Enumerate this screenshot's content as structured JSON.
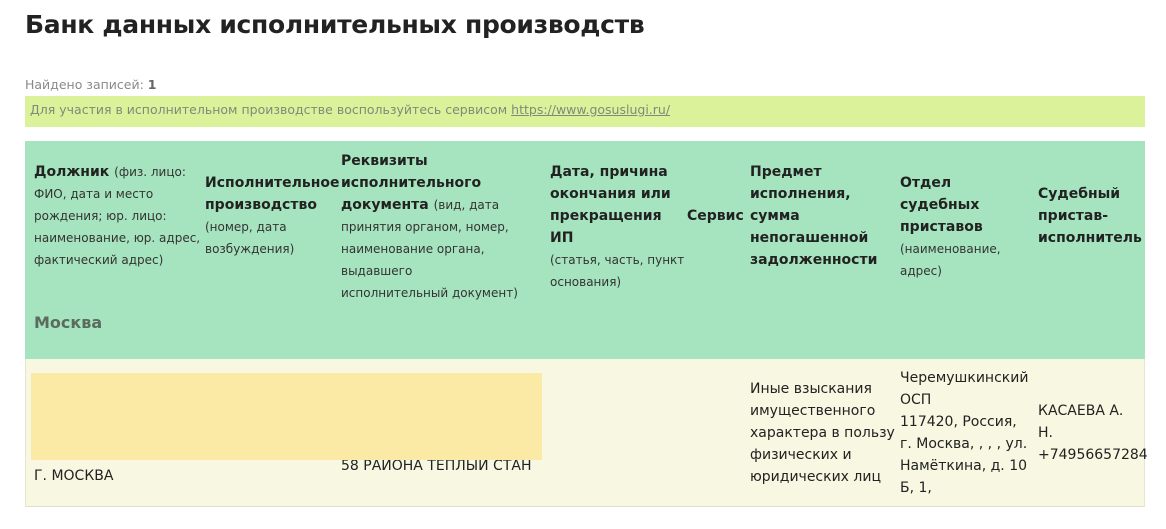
{
  "page": {
    "title": "Банк данных исполнительных производств",
    "found_label": "Найдено записей:",
    "found_count": "1",
    "notice_text": "Для участия в исполнительном производстве воспользуйтесь сервисом ",
    "notice_link": "https://www.gosuslugi.ru/"
  },
  "table": {
    "headers": [
      {
        "bold_lines": [
          "Должник"
        ],
        "inline_sub": "(физ. лицо:",
        "sub_lines": [
          "ФИО, дата и место",
          "рождения; юр. лицо:",
          "наименование, юр. адрес,",
          "фактический адрес)"
        ]
      },
      {
        "bold_lines": [
          "Исполнительное",
          "производство"
        ],
        "sub_lines": [
          "(номер, дата",
          "возбуждения)"
        ]
      },
      {
        "bold_lines": [
          "Реквизиты",
          "исполнительного"
        ],
        "last_bold": "документа",
        "inline_sub": "(вид, дата",
        "sub_lines": [
          "принятия органом, номер,",
          "наименование органа, выдавшего",
          "исполнительный документ)"
        ]
      },
      {
        "bold_lines": [
          "Дата, причина",
          "окончания или",
          "прекращения ИП"
        ],
        "sub_lines": [
          "(статья, часть, пункт",
          "основания)"
        ]
      },
      {
        "bold_lines": [
          "Сервис"
        ]
      },
      {
        "bold_lines": [
          "Предмет",
          "исполнения,",
          "сумма",
          "непогашенной",
          "задолженности"
        ]
      },
      {
        "bold_lines": [
          "Отдел судебных",
          "приставов"
        ],
        "sub_lines": [
          "(наименование,",
          "адрес)"
        ]
      },
      {
        "bold_lines": [
          "Судебный",
          "пристав-",
          "исполнитель"
        ]
      }
    ],
    "region": "Москва",
    "row": {
      "debtor": "Г. МОСКВА",
      "document": "58 РАЙОНА ТЕПЛЫЙ СТАН",
      "subject_lines": [
        "Иные взыскания",
        "имущественного",
        "характера в пользу",
        "физических и",
        "юридических лиц"
      ],
      "department_lines": [
        "Черемушкинский",
        "ОСП",
        "117420, Россия,",
        "г. Москва, , , , ул.",
        "Намёткина, д. 10",
        "Б, 1,"
      ],
      "bailiff_lines": [
        "КАСАЕВА А.",
        "Н.",
        "+74956657284"
      ]
    }
  }
}
